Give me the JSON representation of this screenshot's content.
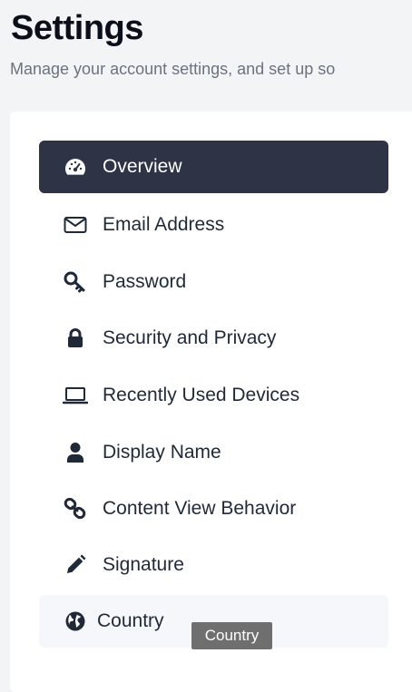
{
  "header": {
    "title": "Settings",
    "subtitle": "Manage your account settings, and set up so"
  },
  "nav": {
    "items": [
      {
        "label": "Overview",
        "icon": "speedometer-icon",
        "state": "active"
      },
      {
        "label": "Email Address",
        "icon": "envelope-icon"
      },
      {
        "label": "Password",
        "icon": "key-icon"
      },
      {
        "label": "Security and Privacy",
        "icon": "lock-icon"
      },
      {
        "label": "Recently Used Devices",
        "icon": "laptop-icon"
      },
      {
        "label": "Display Name",
        "icon": "user-icon"
      },
      {
        "label": "Content View Behavior",
        "icon": "link-icon"
      },
      {
        "label": "Signature",
        "icon": "pencil-icon"
      },
      {
        "label": "Country",
        "icon": "globe-icon",
        "state": "hovered"
      }
    ]
  },
  "tooltip": {
    "text": "Country"
  },
  "colors": {
    "active_bg": "#2e3446",
    "active_text": "#ffffff",
    "text": "#1f2937",
    "muted": "#6b7280",
    "page_bg": "#f3f4f6",
    "panel_bg": "#ffffff",
    "hover_bg": "#f5f7fa",
    "tooltip_bg": "#6f6f6f"
  }
}
